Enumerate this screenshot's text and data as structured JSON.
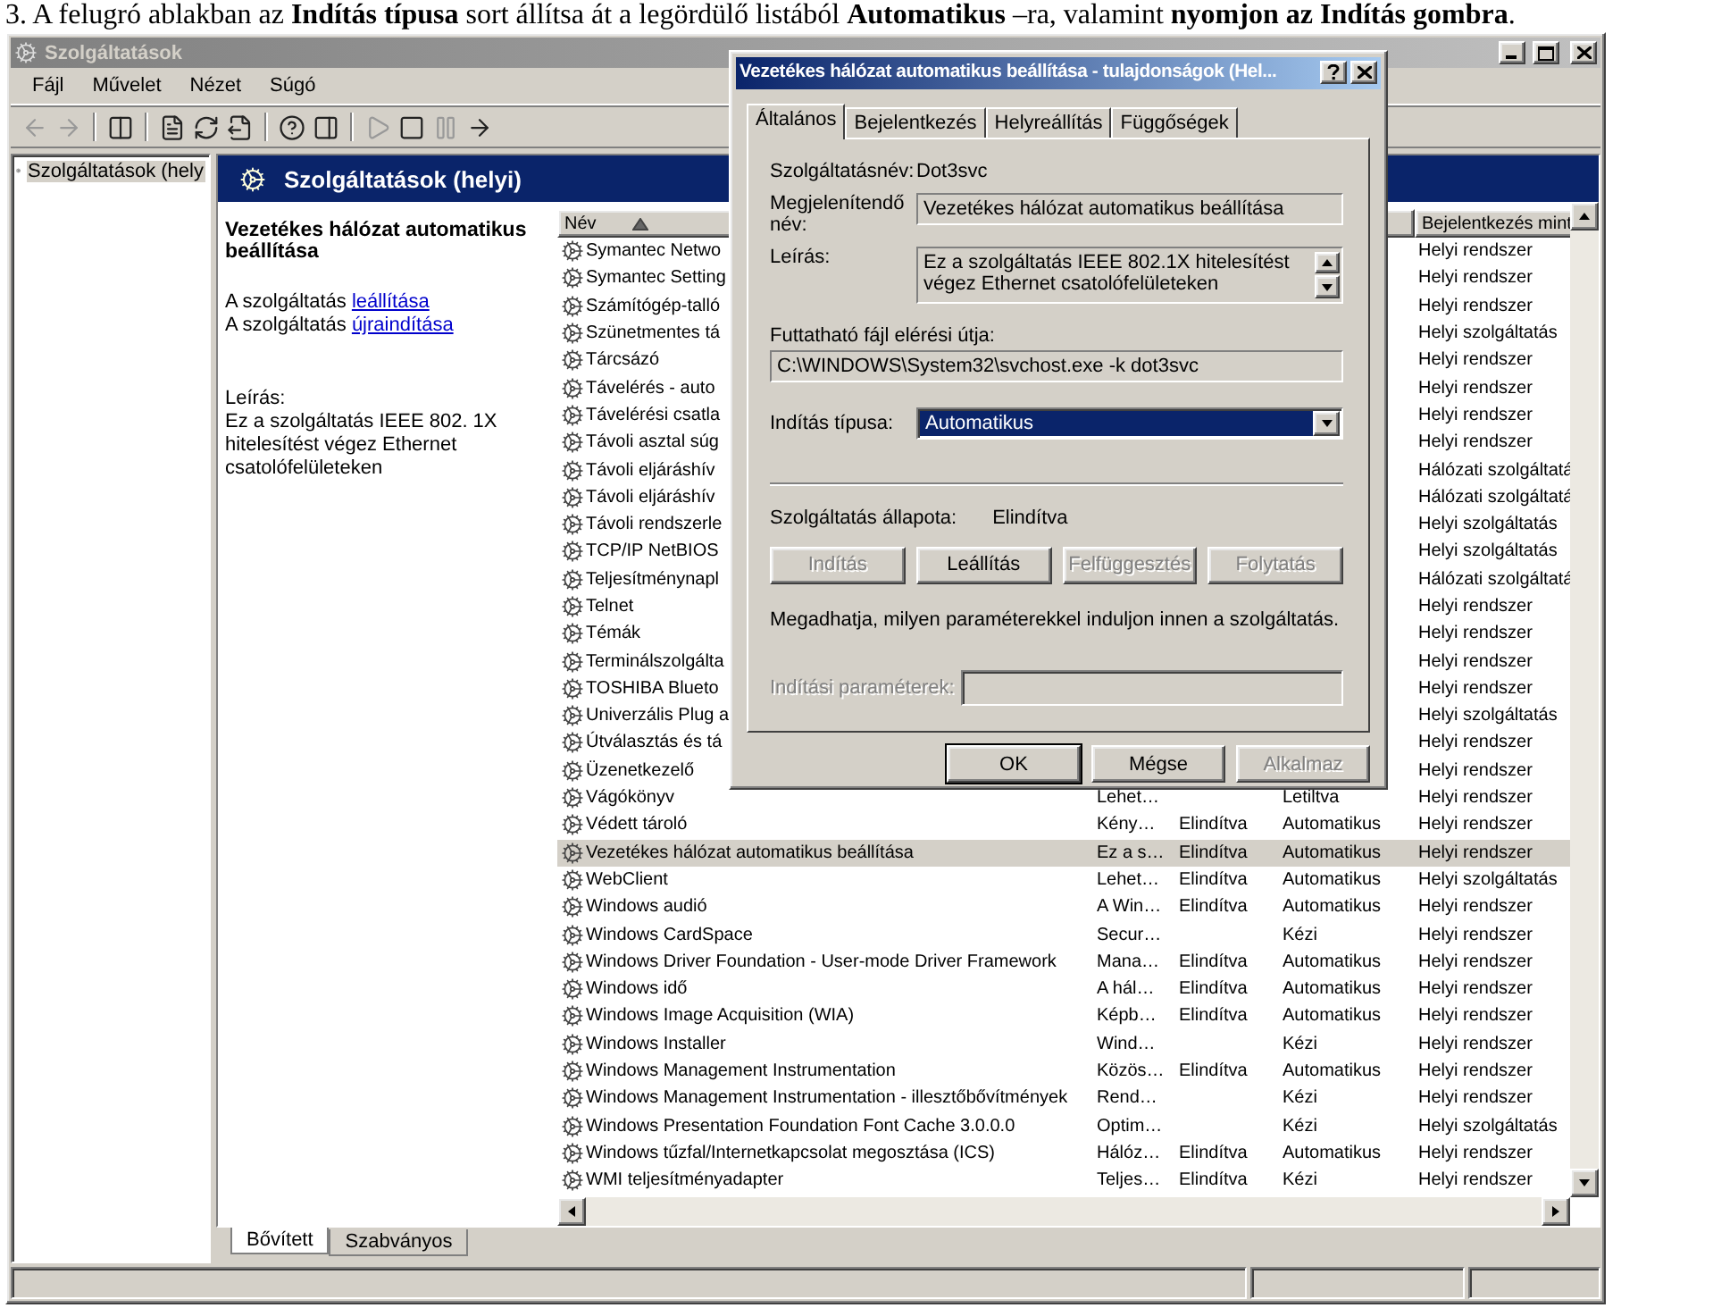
{
  "caption": "3. A felugró ablakban az **Indítás típusa** sort állítsa át a legördülő listából **Automatikus** –ra, valamint **nyomjon az Indítás gombra**.",
  "window": {
    "title": "Szolgáltatások"
  },
  "menu": [
    "Fájl",
    "Művelet",
    "Nézet",
    "Súgó"
  ],
  "tree": [
    {
      "label": "Szolgáltatások (hely",
      "selected": true
    }
  ],
  "pane_header": {
    "title": "Szolgáltatások (helyi)"
  },
  "details": {
    "title": "Vezetékes hálózat automatikus beállítása",
    "actions": [
      {
        "prefix": "A szolgáltatás",
        "link": "leállítása"
      },
      {
        "prefix": "A szolgáltatás",
        "link": "újraindítása"
      }
    ],
    "description_label": "Leírás:",
    "description": "Ez a szolgáltatás IEEE 802. 1X hitelesítést végez Ethernet csatolófelületeken"
  },
  "list": {
    "columns": [
      {
        "label": "Név",
        "sorted": true
      },
      {
        "label": "Bejelentkezés mint"
      }
    ],
    "rows": [
      {
        "name": "Symantec Netwo",
        "logon": "Helyi rendszer",
        "selected": false
      },
      {
        "name": "Symantec Setting",
        "logon": "Helyi rendszer",
        "selected": false
      },
      {
        "name": "Számítógép-talló",
        "logon": "Helyi rendszer",
        "selected": false
      },
      {
        "name": "Szünetmentes tá",
        "logon": "Helyi szolgáltatás",
        "selected": false
      },
      {
        "name": "Tárcsázó",
        "logon": "Helyi rendszer",
        "selected": false
      },
      {
        "name": "Távelérés - auto",
        "logon": "Helyi rendszer",
        "selected": false
      },
      {
        "name": "Távelérési csatla",
        "logon": "Helyi rendszer",
        "selected": false
      },
      {
        "name": "Távoli asztal súg",
        "logon": "Helyi rendszer",
        "selected": false
      },
      {
        "name": "Távoli eljáráshív",
        "logon": "Hálózati szolgáltatá",
        "selected": false
      },
      {
        "name": "Távoli eljáráshív",
        "logon": "Hálózati szolgáltatá",
        "selected": false
      },
      {
        "name": "Távoli rendszerle",
        "logon": "Helyi szolgáltatás",
        "selected": false
      },
      {
        "name": "TCP/IP NetBIOS",
        "logon": "Helyi szolgáltatás",
        "selected": false
      },
      {
        "name": "Teljesítménynapl",
        "logon": "Hálózati szolgáltatá",
        "selected": false
      },
      {
        "name": "Telnet",
        "logon": "Helyi rendszer",
        "selected": false
      },
      {
        "name": "Témák",
        "logon": "Helyi rendszer",
        "selected": false
      },
      {
        "name": "Terminálszolgálta",
        "logon": "Helyi rendszer",
        "selected": false
      },
      {
        "name": "TOSHIBA Blueto",
        "logon": "Helyi rendszer",
        "selected": false
      },
      {
        "name": "Univerzális Plug a",
        "logon": "Helyi szolgáltatás",
        "selected": false
      },
      {
        "name": "Útválasztás és tá",
        "logon": "Helyi rendszer",
        "selected": false
      },
      {
        "name": "Üzenetkezelő",
        "logon": "Helyi rendszer",
        "selected": false
      },
      {
        "name": "Vágókönyv",
        "description": "Lehet…",
        "startup": "Letiltva",
        "logon": "Helyi rendszer",
        "selected": false
      },
      {
        "name": "Védett tároló",
        "description": "Kény…",
        "status": "Elindítva",
        "startup": "Automatikus",
        "logon": "Helyi rendszer",
        "selected": false
      },
      {
        "name": "Vezetékes hálózat automatikus beállítása",
        "description": "Ez a s…",
        "status": "Elindítva",
        "startup": "Automatikus",
        "logon": "Helyi rendszer",
        "selected": true
      },
      {
        "name": "WebClient",
        "description": "Lehet…",
        "status": "Elindítva",
        "startup": "Automatikus",
        "logon": "Helyi szolgáltatás",
        "selected": false
      },
      {
        "name": "Windows audió",
        "description": "A Win…",
        "status": "Elindítva",
        "startup": "Automatikus",
        "logon": "Helyi rendszer",
        "selected": false
      },
      {
        "name": "Windows CardSpace",
        "description": "Secur…",
        "startup": "Kézi",
        "logon": "Helyi rendszer",
        "selected": false
      },
      {
        "name": "Windows Driver Foundation - User-mode Driver Framework",
        "description": "Mana…",
        "status": "Elindítva",
        "startup": "Automatikus",
        "logon": "Helyi rendszer",
        "selected": false
      },
      {
        "name": "Windows idő",
        "description": "A hál…",
        "status": "Elindítva",
        "startup": "Automatikus",
        "logon": "Helyi rendszer",
        "selected": false
      },
      {
        "name": "Windows Image Acquisition (WIA)",
        "description": "Képb…",
        "status": "Elindítva",
        "startup": "Automatikus",
        "logon": "Helyi rendszer",
        "selected": false
      },
      {
        "name": "Windows Installer",
        "description": "Wind…",
        "startup": "Kézi",
        "logon": "Helyi rendszer",
        "selected": false
      },
      {
        "name": "Windows Management Instrumentation",
        "description": "Közös…",
        "status": "Elindítva",
        "startup": "Automatikus",
        "logon": "Helyi rendszer",
        "selected": false
      },
      {
        "name": "Windows Management Instrumentation - illesztőbővítmények",
        "description": "Rend…",
        "startup": "Kézi",
        "logon": "Helyi rendszer",
        "selected": false
      },
      {
        "name": "Windows Presentation Foundation Font Cache 3.0.0.0",
        "description": "Optim…",
        "startup": "Kézi",
        "logon": "Helyi szolgáltatás",
        "selected": false
      },
      {
        "name": "Windows tűzfal/Internetkapcsolat megosztása (ICS)",
        "description": "Hálóz…",
        "status": "Elindítva",
        "startup": "Automatikus",
        "logon": "Helyi rendszer",
        "selected": false
      },
      {
        "name": "WMI teljesítményadapter",
        "description": "Teljes…",
        "status": "Elindítva",
        "startup": "Kézi",
        "logon": "Helyi rendszer",
        "selected": false
      }
    ]
  },
  "view_tabs": [
    {
      "label": "Bővített",
      "selected": true
    },
    {
      "label": "Szabványos",
      "selected": false
    }
  ],
  "dialog": {
    "title": "Vezetékes hálózat automatikus beállítása - tulajdonságok (Hel...",
    "tabs": [
      {
        "label": "Általános",
        "selected": true
      },
      {
        "label": "Bejelentkezés",
        "selected": false
      },
      {
        "label": "Helyreállítás",
        "selected": false
      },
      {
        "label": "Függőségek",
        "selected": false
      }
    ],
    "fields": [
      {
        "kind": "text",
        "label": "Szolgáltatásnév:",
        "value": "Dot3svc"
      },
      {
        "kind": "readonly",
        "label": "Megjelenítendő név:",
        "value": "Vezetékes hálózat automatikus beállítása"
      },
      {
        "kind": "memo",
        "label": "Leírás:",
        "value": "Ez a szolgáltatás IEEE 802.1X hitelesítést végez Ethernet csatolófelületeken"
      },
      {
        "kind": "path",
        "label": "Futtatható fájl elérési útja:",
        "value": "C:\\WINDOWS\\System32\\svchost.exe -k dot3svc"
      },
      {
        "kind": "select",
        "label": "Indítás típusa:",
        "value": "Automatikus"
      }
    ],
    "status": {
      "label": "Szolgáltatás állapota:",
      "value": "Elindítva"
    },
    "service_buttons": [
      {
        "label": "Indítás",
        "disabled": true
      },
      {
        "label": "Leállítás",
        "disabled": false
      },
      {
        "label": "Felfüggesztés",
        "disabled": true
      },
      {
        "label": "Folytatás",
        "disabled": true
      }
    ],
    "hint": "Megadhatja, milyen paraméterekkel induljon innen a szolgáltatás.",
    "parameters": {
      "label": "Indítási paraméterek:",
      "disabled": true
    },
    "buttons": [
      {
        "label": "OK",
        "default": true,
        "disabled": false
      },
      {
        "label": "Mégse",
        "default": false,
        "disabled": false
      },
      {
        "label": "Alkalmaz",
        "default": false,
        "disabled": true
      }
    ]
  }
}
